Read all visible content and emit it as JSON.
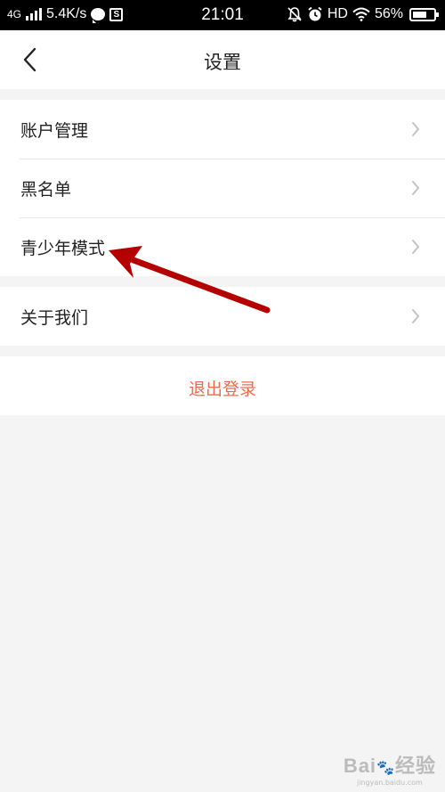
{
  "status_bar": {
    "network_type": "4G",
    "speed": "5.4K/s",
    "s_badge": "S",
    "time": "21:01",
    "hd": "HD",
    "battery": "56%"
  },
  "header": {
    "title": "设置"
  },
  "menu": {
    "groups": [
      {
        "items": [
          {
            "label": "账户管理"
          },
          {
            "label": "黑名单"
          },
          {
            "label": "青少年模式"
          }
        ]
      },
      {
        "items": [
          {
            "label": "关于我们"
          }
        ]
      }
    ],
    "logout_label": "退出登录"
  },
  "annotation": {
    "color": "#b40000"
  },
  "colors": {
    "accent_logout": "#f06a4f",
    "background": "#f4f4f4"
  },
  "icons": [
    "back-arrow-icon",
    "chevron-right-icon",
    "signal-icon",
    "chat-bubble-icon",
    "wifi-icon",
    "alarm-icon",
    "mute-bell-icon",
    "battery-icon"
  ]
}
